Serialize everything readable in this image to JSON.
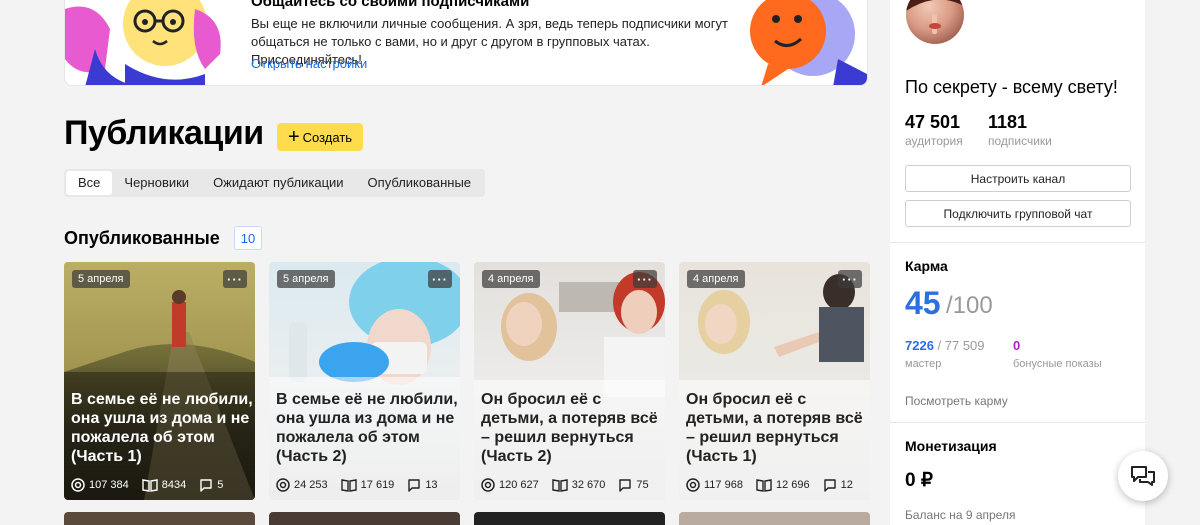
{
  "banner": {
    "title": "Общайтесь со своими подписчиками",
    "text": "Вы еще не включили личные сообщения. А зря, ведь теперь подписчики могут общаться не только с вами, но и друг с другом в групповых чатах. Присоединяйтесь!",
    "link": "Открыть настройки"
  },
  "header": {
    "title": "Публикации",
    "create_label": "Создать"
  },
  "tabs": [
    {
      "label": "Все"
    },
    {
      "label": "Черновики"
    },
    {
      "label": "Ожидают публикации"
    },
    {
      "label": "Опубликованные"
    }
  ],
  "section": {
    "title": "Опубликованные",
    "count": "10"
  },
  "cards": [
    {
      "date": "5 апреля",
      "title": "В семье её не любили, она ушла из дома и не пожалела об этом (Часть 1)",
      "views": "107 384",
      "reads": "8434",
      "comments": "5"
    },
    {
      "date": "5 апреля",
      "title": "В семье её не любили, она ушла из дома и не пожалела об этом (Часть 2)",
      "views": "24 253",
      "reads": "17 619",
      "comments": "13"
    },
    {
      "date": "4 апреля",
      "title": "Он бросил её с детьми, а потеряв всё – решил вернуться (Часть 2)",
      "views": "120 627",
      "reads": "32 670",
      "comments": "75"
    },
    {
      "date": "4 апреля",
      "title": "Он бросил её с детьми, а потеряв всё – решил вернуться (Часть 1)",
      "views": "117 968",
      "reads": "12 696",
      "comments": "12"
    }
  ],
  "sidebar": {
    "channel_name": "По секрету - всему свету!",
    "audience_value": "47 501",
    "audience_label": "аудитория",
    "subscribers_value": "1181",
    "subscribers_label": "подписчики",
    "configure_button": "Настроить канал",
    "group_chat_button": "Подключить групповой чат",
    "karma": {
      "heading": "Карма",
      "value": "45",
      "max": "/100",
      "master_value": "7226",
      "master_total": " / 77 509",
      "master_label": "мастер",
      "bonus_value": "0",
      "bonus_label": "бонусные показы",
      "link": "Посмотреть карму"
    },
    "monetization": {
      "heading": "Монетизация",
      "amount": "0 ₽",
      "balance": "Баланс на 9 апреля"
    }
  },
  "colors": {
    "accent_yellow": "#ffdb4d",
    "link_blue": "#1a6dde",
    "karma_blue": "#2b6fe0",
    "bonus_purple": "#b01ec4"
  }
}
